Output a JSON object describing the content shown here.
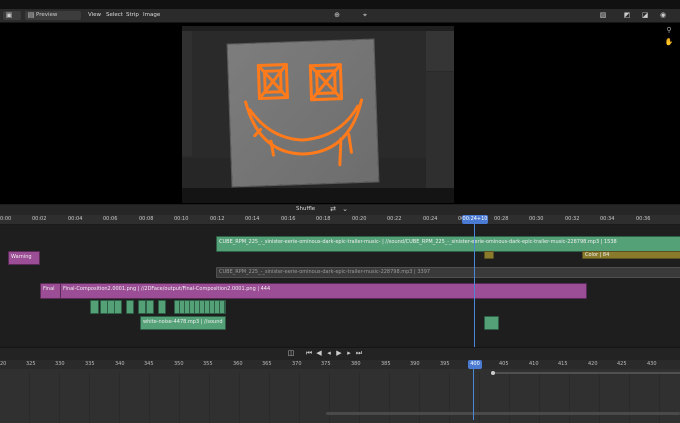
{
  "header": {
    "editor_type": "Preview",
    "menus": [
      "View",
      "Select",
      "Strip",
      "Image"
    ]
  },
  "preview_render": {
    "viewport_header": "Shuffle"
  },
  "ruler": {
    "ticks": [
      "0:00",
      "00:02",
      "00:04",
      "00:06",
      "00:08",
      "00:10",
      "00:12",
      "00:14",
      "00:16",
      "00:18",
      "00:20",
      "00:22",
      "00:24",
      "00:26",
      "00:28",
      "00:30",
      "00:32",
      "00:34",
      "00:36"
    ],
    "playhead_label": "00:24+10"
  },
  "strips": {
    "sound1": "CUBE_RPM_225_-_sinister-eerie-ominous-dark-epic-trailer-music- | //sound/CUBE_RPM_225_-_sinister-eerie-ominous-dark-epic-trailer-music-228798.mp3 | 1538",
    "warning": "Warning",
    "color": "Color | 84",
    "sound_muted": "CUBE_RPM_225_-_sinister-eerie-ominous-dark-epic-trailer-music-228798.mp3 | 3397",
    "final_label": "Final",
    "final_comp": "Final-Composition2.0001.png | //2DFace/output/Final-Composition2.0001.png | 444",
    "white_noise": "white-noise-4478.mp3 | //sound"
  },
  "timeline": {
    "ticks": [
      "20",
      "325",
      "330",
      "335",
      "340",
      "345",
      "350",
      "355",
      "360",
      "365",
      "370",
      "375",
      "380",
      "385",
      "390",
      "395",
      "400",
      "405",
      "410",
      "415",
      "420",
      "425",
      "430"
    ],
    "current_frame": "400"
  },
  "colors": {
    "sound_strip": "#54a178",
    "image_strip": "#9b4d95",
    "color_strip": "#8a7a2c",
    "playhead": "#4a87d6",
    "smiley": "#ff7a1a"
  }
}
